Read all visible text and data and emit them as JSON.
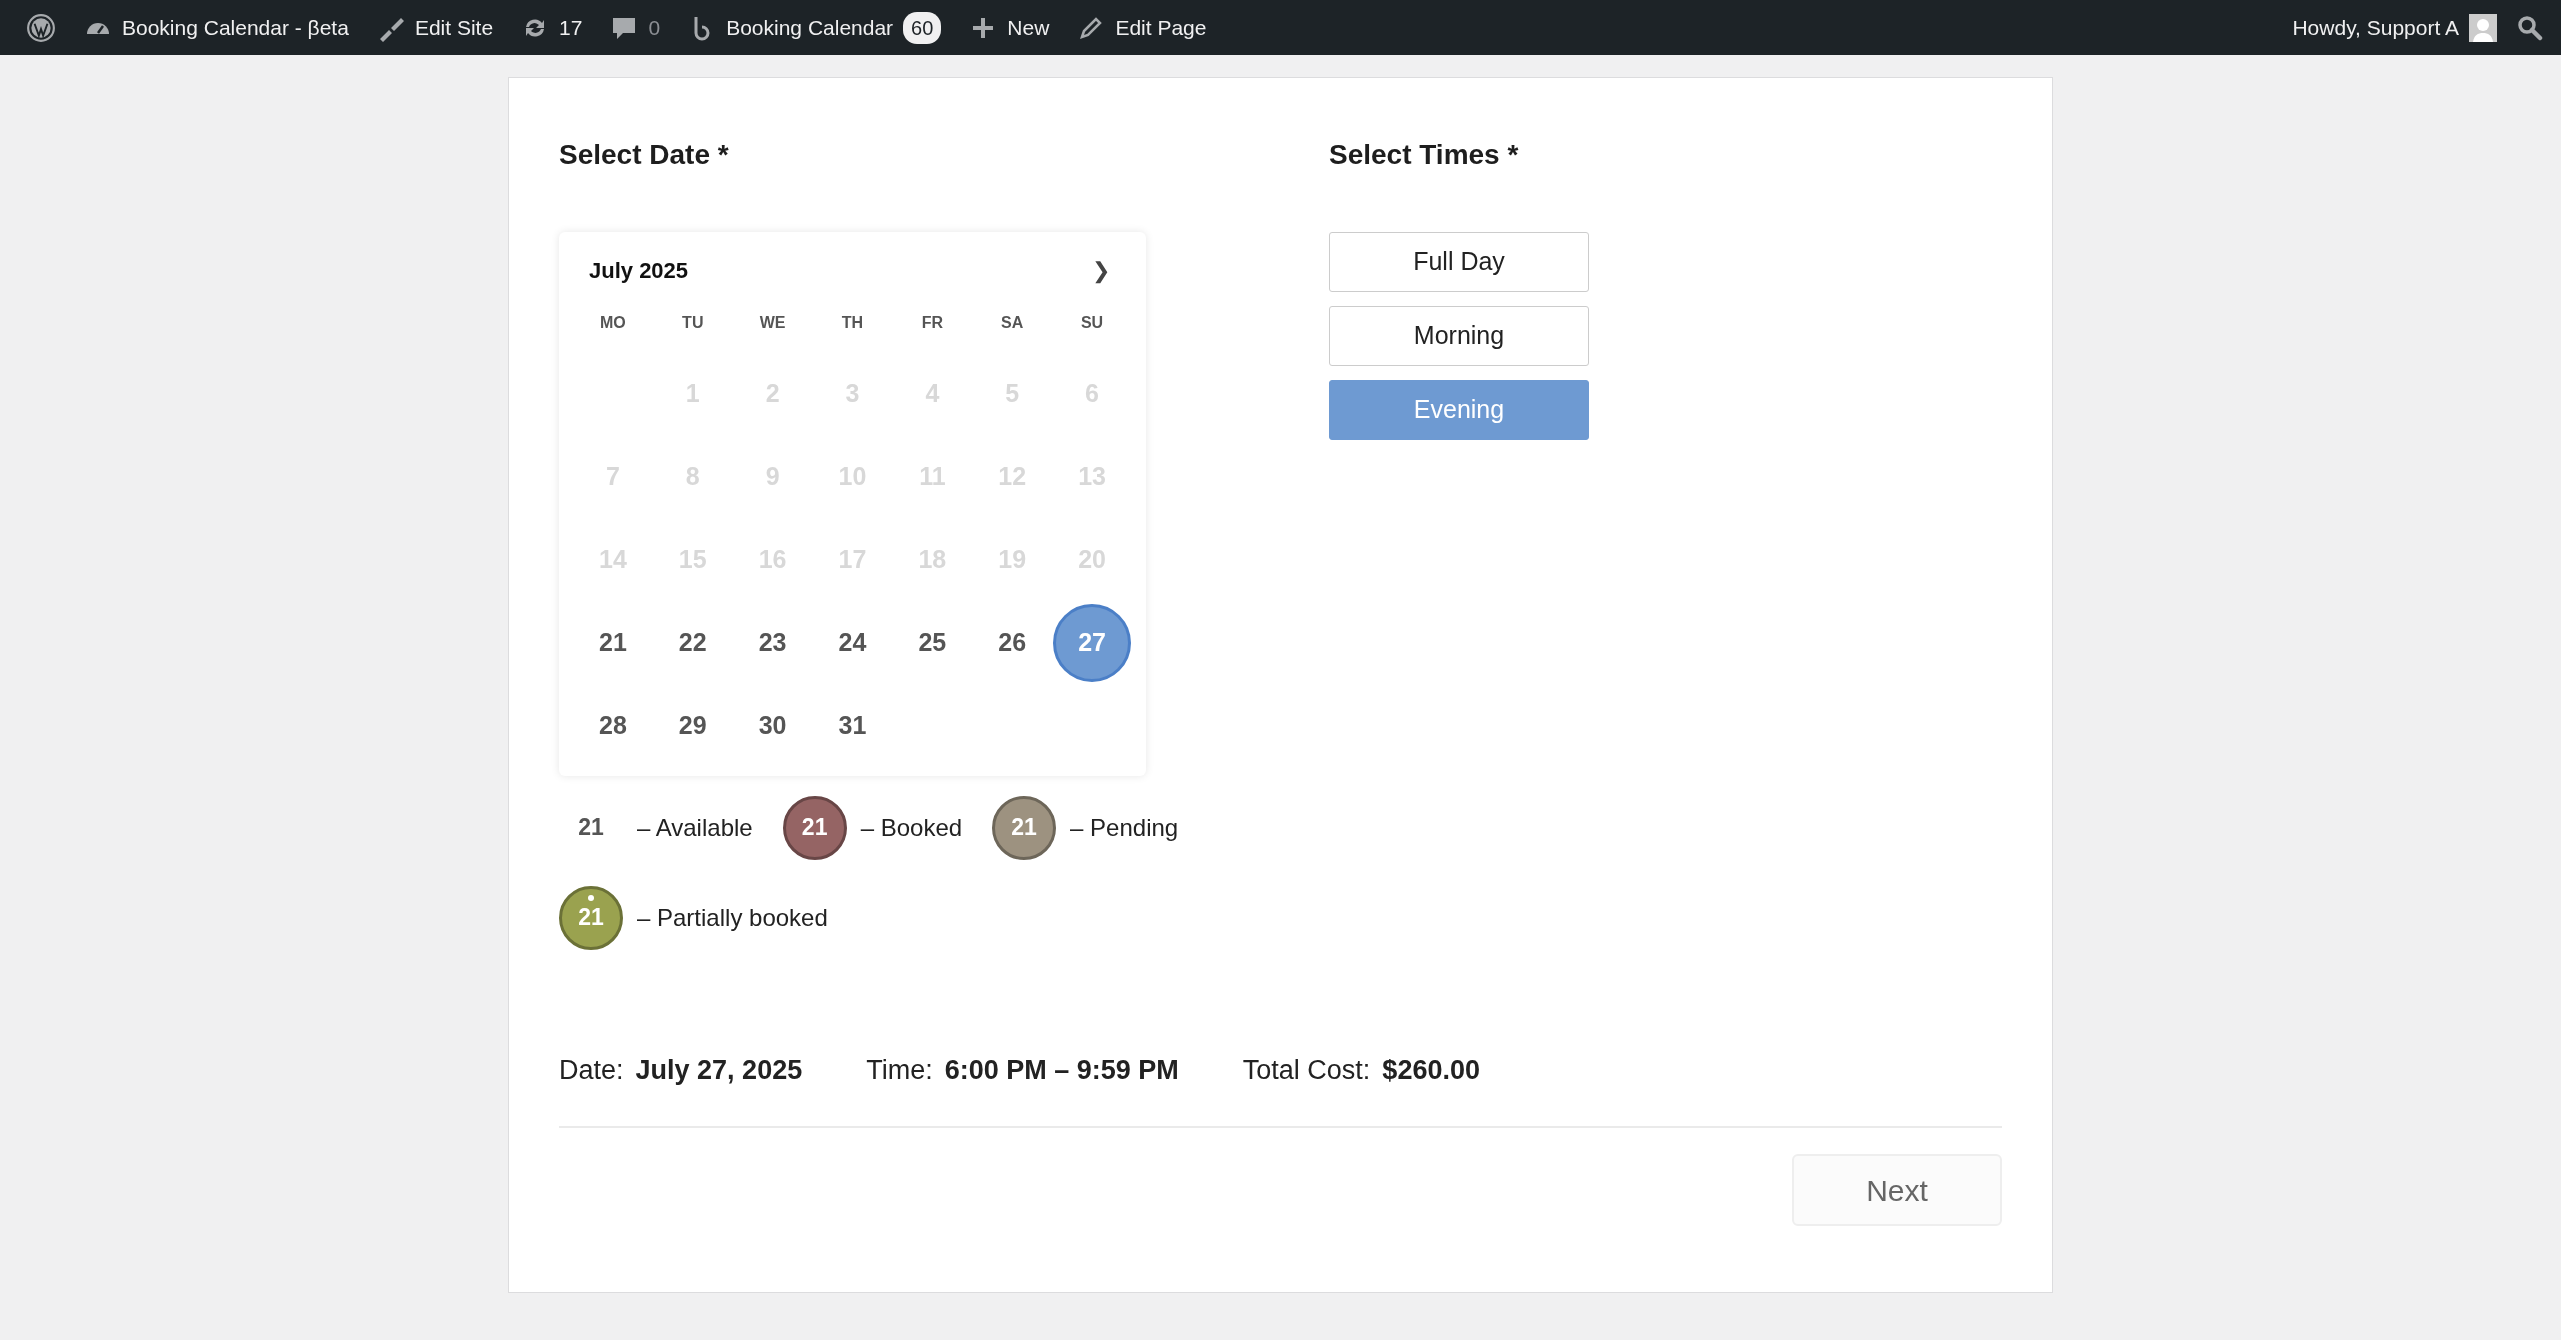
{
  "admin_bar": {
    "left": [
      {
        "kind": "wp"
      },
      {
        "kind": "dashboard",
        "label": "Booking Calendar - βeta"
      },
      {
        "kind": "brush",
        "label": "Edit Site"
      },
      {
        "kind": "updates",
        "label": "17"
      },
      {
        "kind": "comments",
        "label": "0"
      },
      {
        "kind": "booking",
        "label": "Booking Calendar",
        "badge": "60"
      },
      {
        "kind": "new",
        "label": "New"
      },
      {
        "kind": "edit",
        "label": "Edit Page"
      }
    ],
    "greeting": "Howdy, Support A"
  },
  "date_section": {
    "heading": "Select Date *",
    "calendar": {
      "month": "July 2025",
      "next": "❯",
      "weekdays": [
        "MO",
        "TU",
        "WE",
        "TH",
        "FR",
        "SA",
        "SU"
      ],
      "weeks": [
        [
          {
            "kind": "blank"
          },
          {
            "kind": "unavailable",
            "label": "1",
            "selected": false
          },
          {
            "kind": "unavailable",
            "label": "2",
            "selected": false
          },
          {
            "kind": "unavailable",
            "label": "3",
            "selected": false
          },
          {
            "kind": "unavailable",
            "label": "4",
            "selected": false
          },
          {
            "kind": "unavailable",
            "label": "5",
            "selected": false
          },
          {
            "kind": "unavailable",
            "label": "6",
            "selected": false
          }
        ],
        [
          {
            "kind": "unavailable",
            "label": "7",
            "selected": false
          },
          {
            "kind": "unavailable",
            "label": "8",
            "selected": false
          },
          {
            "kind": "unavailable",
            "label": "9",
            "selected": false
          },
          {
            "kind": "unavailable",
            "label": "10",
            "selected": false
          },
          {
            "kind": "unavailable",
            "label": "11",
            "selected": false
          },
          {
            "kind": "unavailable",
            "label": "12",
            "selected": false
          },
          {
            "kind": "unavailable",
            "label": "13",
            "selected": false
          }
        ],
        [
          {
            "kind": "unavailable",
            "label": "14",
            "selected": false
          },
          {
            "kind": "unavailable",
            "label": "15",
            "selected": false
          },
          {
            "kind": "unavailable",
            "label": "16",
            "selected": false
          },
          {
            "kind": "unavailable",
            "label": "17",
            "selected": false
          },
          {
            "kind": "unavailable",
            "label": "18",
            "selected": false
          },
          {
            "kind": "unavailable",
            "label": "19",
            "selected": false
          },
          {
            "kind": "unavailable",
            "label": "20",
            "selected": false
          }
        ],
        [
          {
            "kind": "available",
            "label": "21",
            "selected": false
          },
          {
            "kind": "available",
            "label": "22",
            "selected": false
          },
          {
            "kind": "available",
            "label": "23",
            "selected": false
          },
          {
            "kind": "available",
            "label": "24",
            "selected": false
          },
          {
            "kind": "available",
            "label": "25",
            "selected": false
          },
          {
            "kind": "available",
            "label": "26",
            "selected": false
          },
          {
            "kind": "available",
            "label": "27",
            "selected": true
          }
        ],
        [
          {
            "kind": "available",
            "label": "28",
            "selected": false
          },
          {
            "kind": "available",
            "label": "29",
            "selected": false
          },
          {
            "kind": "available",
            "label": "30",
            "selected": false
          },
          {
            "kind": "available",
            "label": "31",
            "selected": false
          }
        ]
      ]
    },
    "legend": [
      {
        "kind": "available",
        "day": "21",
        "label": "– Available"
      },
      {
        "kind": "booked",
        "day": "21",
        "label": "– Booked",
        "color": "#956464"
      },
      {
        "kind": "pending",
        "day": "21",
        "label": "– Pending",
        "color": "#9d9280"
      },
      {
        "kind": "partial",
        "day": "21",
        "label": "– Partially booked",
        "color": "#9aa24f"
      }
    ]
  },
  "times_section": {
    "heading": "Select Times *",
    "slots": [
      {
        "label": "Full Day",
        "selected": false
      },
      {
        "label": "Morning",
        "selected": false
      },
      {
        "label": "Evening",
        "selected": true
      }
    ]
  },
  "summary": [
    {
      "label": "Date:",
      "value": "July 27, 2025"
    },
    {
      "label": "Time:",
      "value": "6:00 PM – 9:59 PM"
    },
    {
      "label": "Total Cost:",
      "value": "$260.00"
    }
  ],
  "next_button": "Next"
}
